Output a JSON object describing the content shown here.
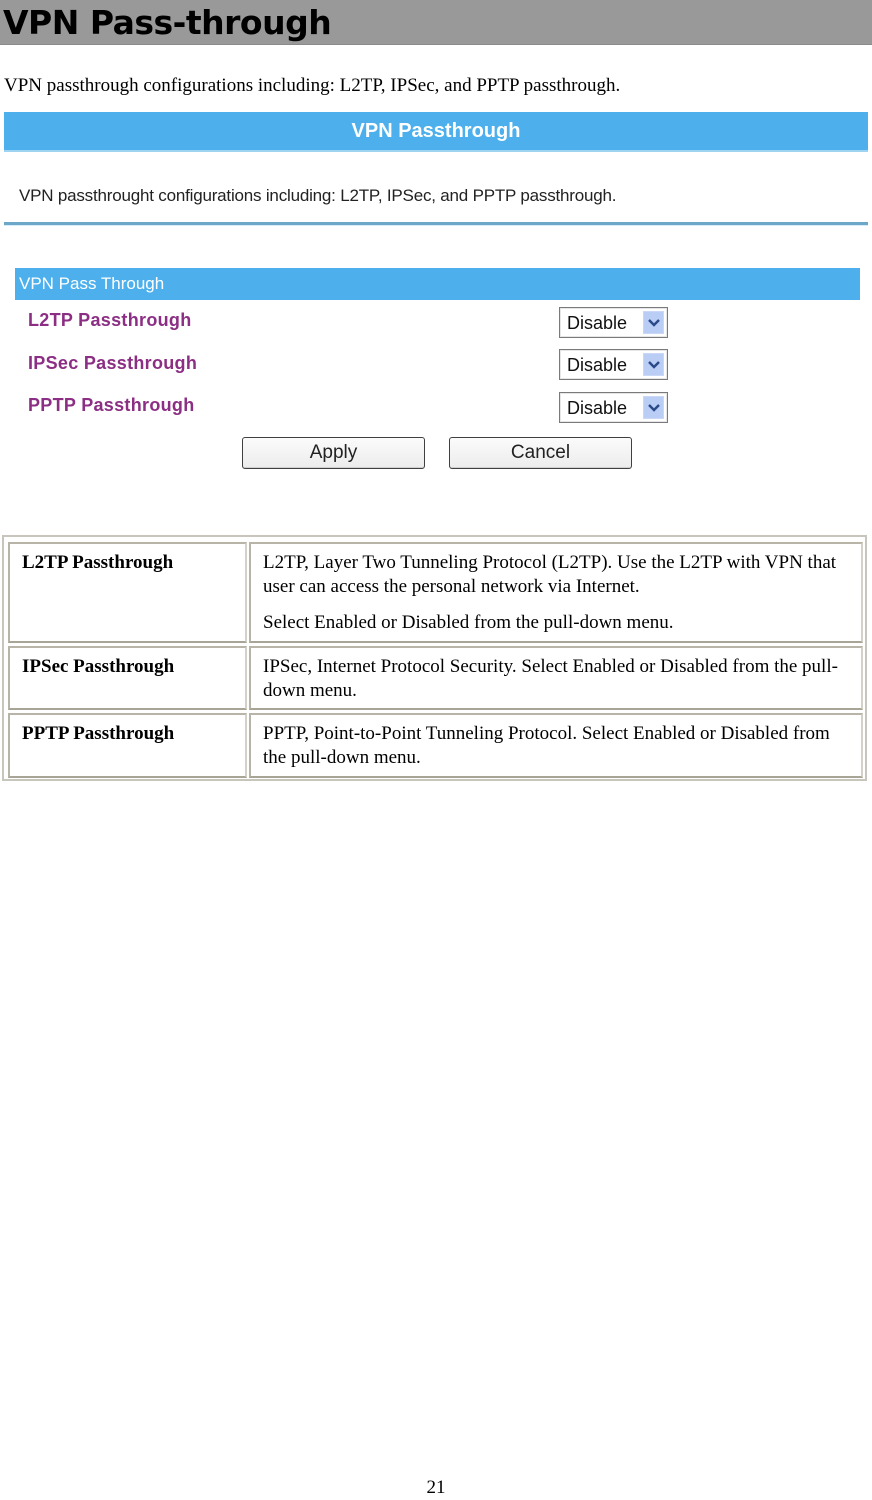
{
  "heading": "VPN Pass-through",
  "intro": "VPN passthrough configurations including: L2TP, IPSec, and PPTP passthrough.",
  "screenshot": {
    "title": "VPN Passthrough",
    "description": "VPN passthrought configurations including: L2TP, IPSec, and PPTP passthrough.",
    "section_title": "VPN Pass Through",
    "rows": [
      {
        "label": "L2TP Passthrough",
        "value": "Disable"
      },
      {
        "label": "IPSec Passthrough",
        "value": "Disable"
      },
      {
        "label": "PPTP Passthrough",
        "value": "Disable"
      }
    ],
    "apply_label": "Apply",
    "cancel_label": "Cancel",
    "colors": {
      "bar": "#4db0ec",
      "label": "#8b2e84"
    }
  },
  "definitions": [
    {
      "term": "L2TP Passthrough",
      "text": [
        "L2TP, Layer Two Tunneling Protocol (L2TP). Use the L2TP with VPN that user can access the personal network via Internet.",
        "Select Enabled or Disabled from the pull-down menu."
      ]
    },
    {
      "term": "IPSec Passthrough",
      "text": [
        "IPSec, Internet Protocol Security. Select Enabled or Disabled from the pull-down menu."
      ]
    },
    {
      "term": "PPTP Passthrough",
      "text": [
        "PPTP, Point-to-Point Tunneling Protocol. Select Enabled or Disabled from the pull-down menu."
      ]
    }
  ],
  "page_number": "21"
}
